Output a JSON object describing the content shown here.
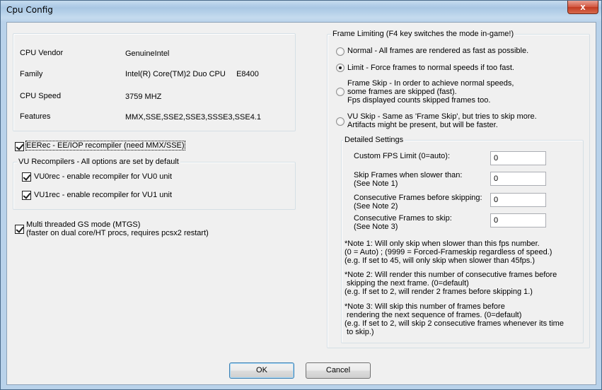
{
  "window": {
    "title": "Cpu Config",
    "close_glyph": "x"
  },
  "cpu_info": {
    "rows": [
      {
        "label": "CPU Vendor",
        "value": "GenuineIntel"
      },
      {
        "label": "Family",
        "value": "Intel(R) Core(TM)2 Duo CPU     E8400"
      },
      {
        "label": "CPU Speed",
        "value": "3759 MHZ"
      },
      {
        "label": "Features",
        "value": "MMX,SSE,SSE2,SSE3,SSSE3,SSE4.1"
      }
    ]
  },
  "eerec": {
    "label": "EERec -  EE/IOP recompiler (need MMX/SSE)",
    "checked": true
  },
  "vu_group": {
    "title": "VU Recompilers - All options are set by default",
    "vu0": {
      "label": "VU0rec - enable recompiler for VU0 unit",
      "checked": true
    },
    "vu1": {
      "label": "VU1rec - enable recompiler for VU1 unit",
      "checked": true
    }
  },
  "mtgs": {
    "label": "Multi threaded GS mode (MTGS)\n(faster on dual core/HT procs, requires pcsx2 restart)",
    "checked": true
  },
  "frame_limiting": {
    "title": "Frame Limiting (F4 key switches the mode in-game!)",
    "options": [
      {
        "label": "Normal - All frames are rendered as fast as possible.",
        "selected": false
      },
      {
        "label": "Limit - Force frames to normal speeds if too fast.",
        "selected": true
      },
      {
        "label": "Frame Skip - In order to achieve normal speeds,\nsome frames are skipped (fast).\nFps displayed counts skipped frames too.",
        "selected": false
      },
      {
        "label": "VU Skip - Same as 'Frame Skip', but tries to skip more.\nArtifacts might be present, but will be faster.",
        "selected": false
      }
    ],
    "detailed": {
      "title": "Detailed Settings",
      "fields": [
        {
          "label": "Custom FPS Limit (0=auto):",
          "value": "0"
        },
        {
          "label": "Skip Frames when slower than:\n(See Note 1)",
          "value": "0"
        },
        {
          "label": "Consecutive Frames before skipping:\n(See Note 2)",
          "value": "0"
        },
        {
          "label": "Consecutive Frames to skip:\n(See Note 3)",
          "value": "0"
        }
      ],
      "notes": [
        "*Note 1: Will only skip when slower than this fps number.\n(0 = Auto) ; (9999 = Forced-Frameskip regardless of speed.)\n(e.g. If set to 45, will only skip when slower than 45fps.)",
        "*Note 2: Will render this number of consecutive frames before\n skipping the next frame. (0=default)\n(e.g. If set to 2, will render 2 frames before skipping 1.)",
        "*Note 3: Will skip this number of frames before\n rendering the next sequence of frames. (0=default)\n(e.g. If set to 2, will skip 2 consecutive frames whenever its time\n to skip.)"
      ]
    }
  },
  "buttons": {
    "ok": "OK",
    "cancel": "Cancel"
  }
}
